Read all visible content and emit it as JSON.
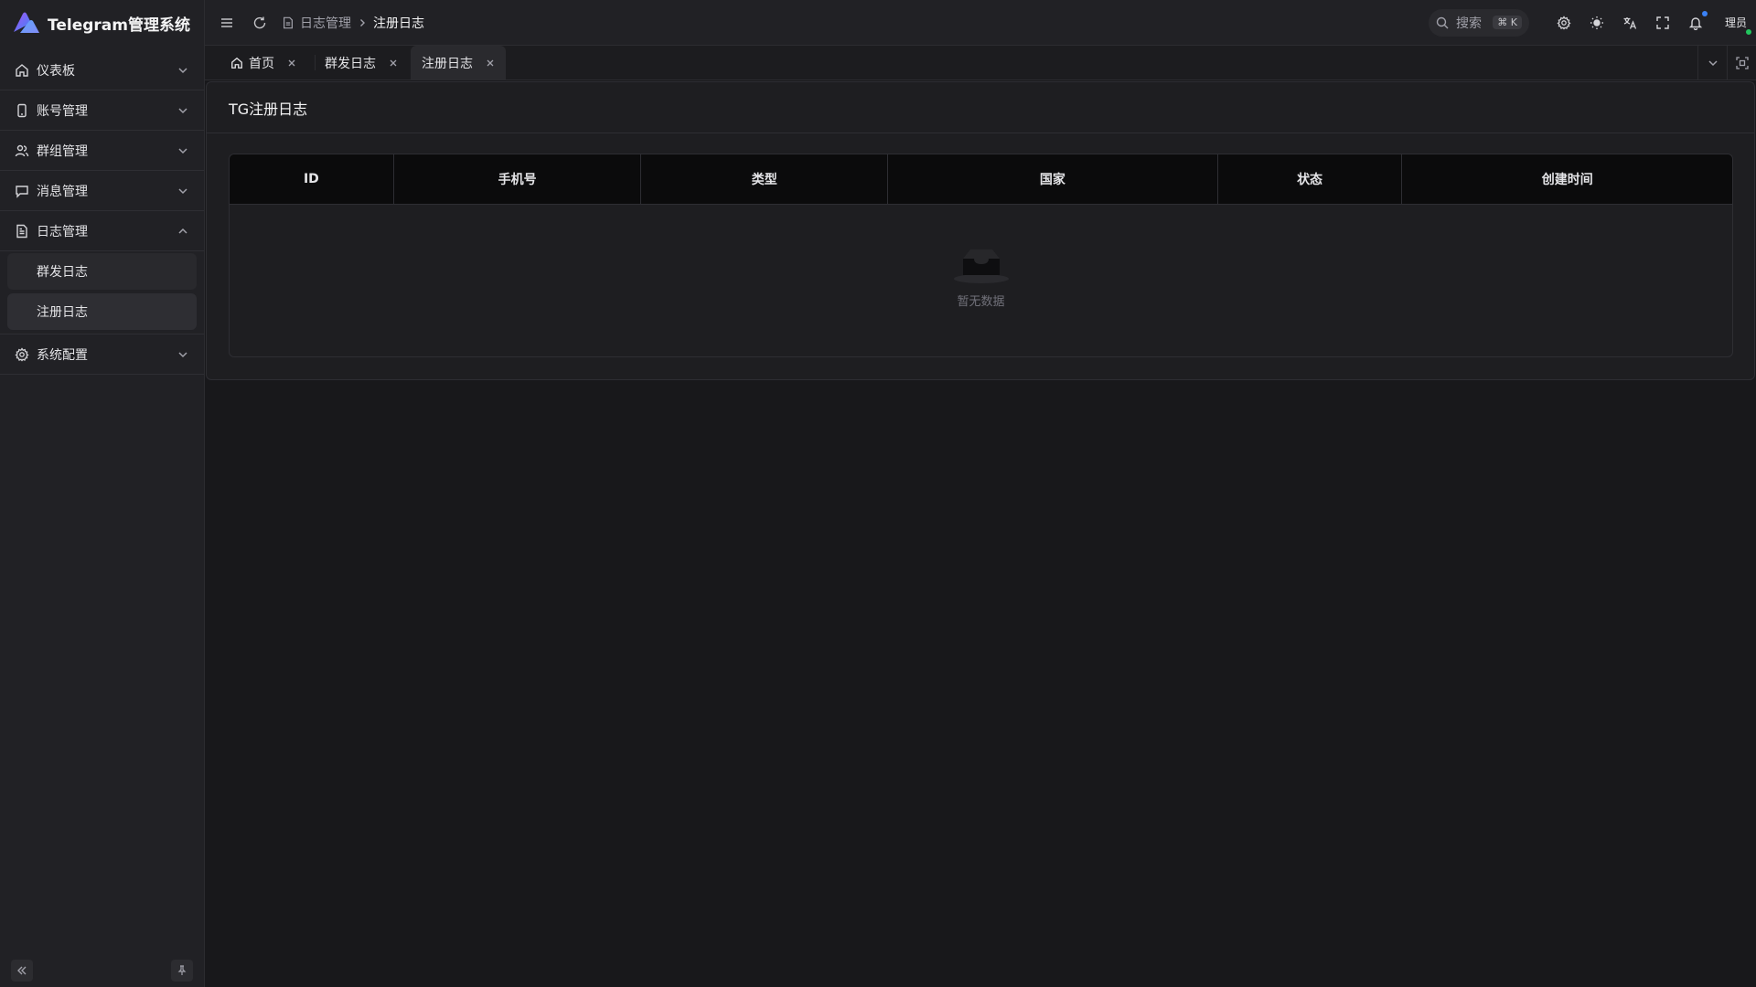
{
  "app": {
    "title": "Telegram管理系统"
  },
  "sidebar": {
    "items": [
      {
        "label": "仪表板",
        "icon": "home-icon"
      },
      {
        "label": "账号管理",
        "icon": "phone-icon"
      },
      {
        "label": "群组管理",
        "icon": "users-icon"
      },
      {
        "label": "消息管理",
        "icon": "message-icon"
      },
      {
        "label": "日志管理",
        "icon": "file-icon",
        "expanded": true,
        "children": [
          {
            "label": "群发日志"
          },
          {
            "label": "注册日志",
            "active": true
          }
        ]
      },
      {
        "label": "系统配置",
        "icon": "gear-icon"
      }
    ]
  },
  "header": {
    "breadcrumb": {
      "parent": "日志管理",
      "current": "注册日志"
    },
    "search": {
      "placeholder": "搜索",
      "shortcut": "⌘ K"
    },
    "user": {
      "name": "理员",
      "status_color": "#22c55e"
    },
    "notification_dot_color": "#3b82f6"
  },
  "tabs": [
    {
      "label": "首页",
      "icon": "home-icon"
    },
    {
      "label": "群发日志"
    },
    {
      "label": "注册日志",
      "active": true
    }
  ],
  "page": {
    "title": "TG注册日志",
    "table": {
      "columns": [
        "ID",
        "手机号",
        "类型",
        "国家",
        "状态",
        "创建时间"
      ],
      "rows": [],
      "empty_text": "暂无数据"
    }
  },
  "colors": {
    "accent": "#3b82f6",
    "online": "#22c55e"
  }
}
